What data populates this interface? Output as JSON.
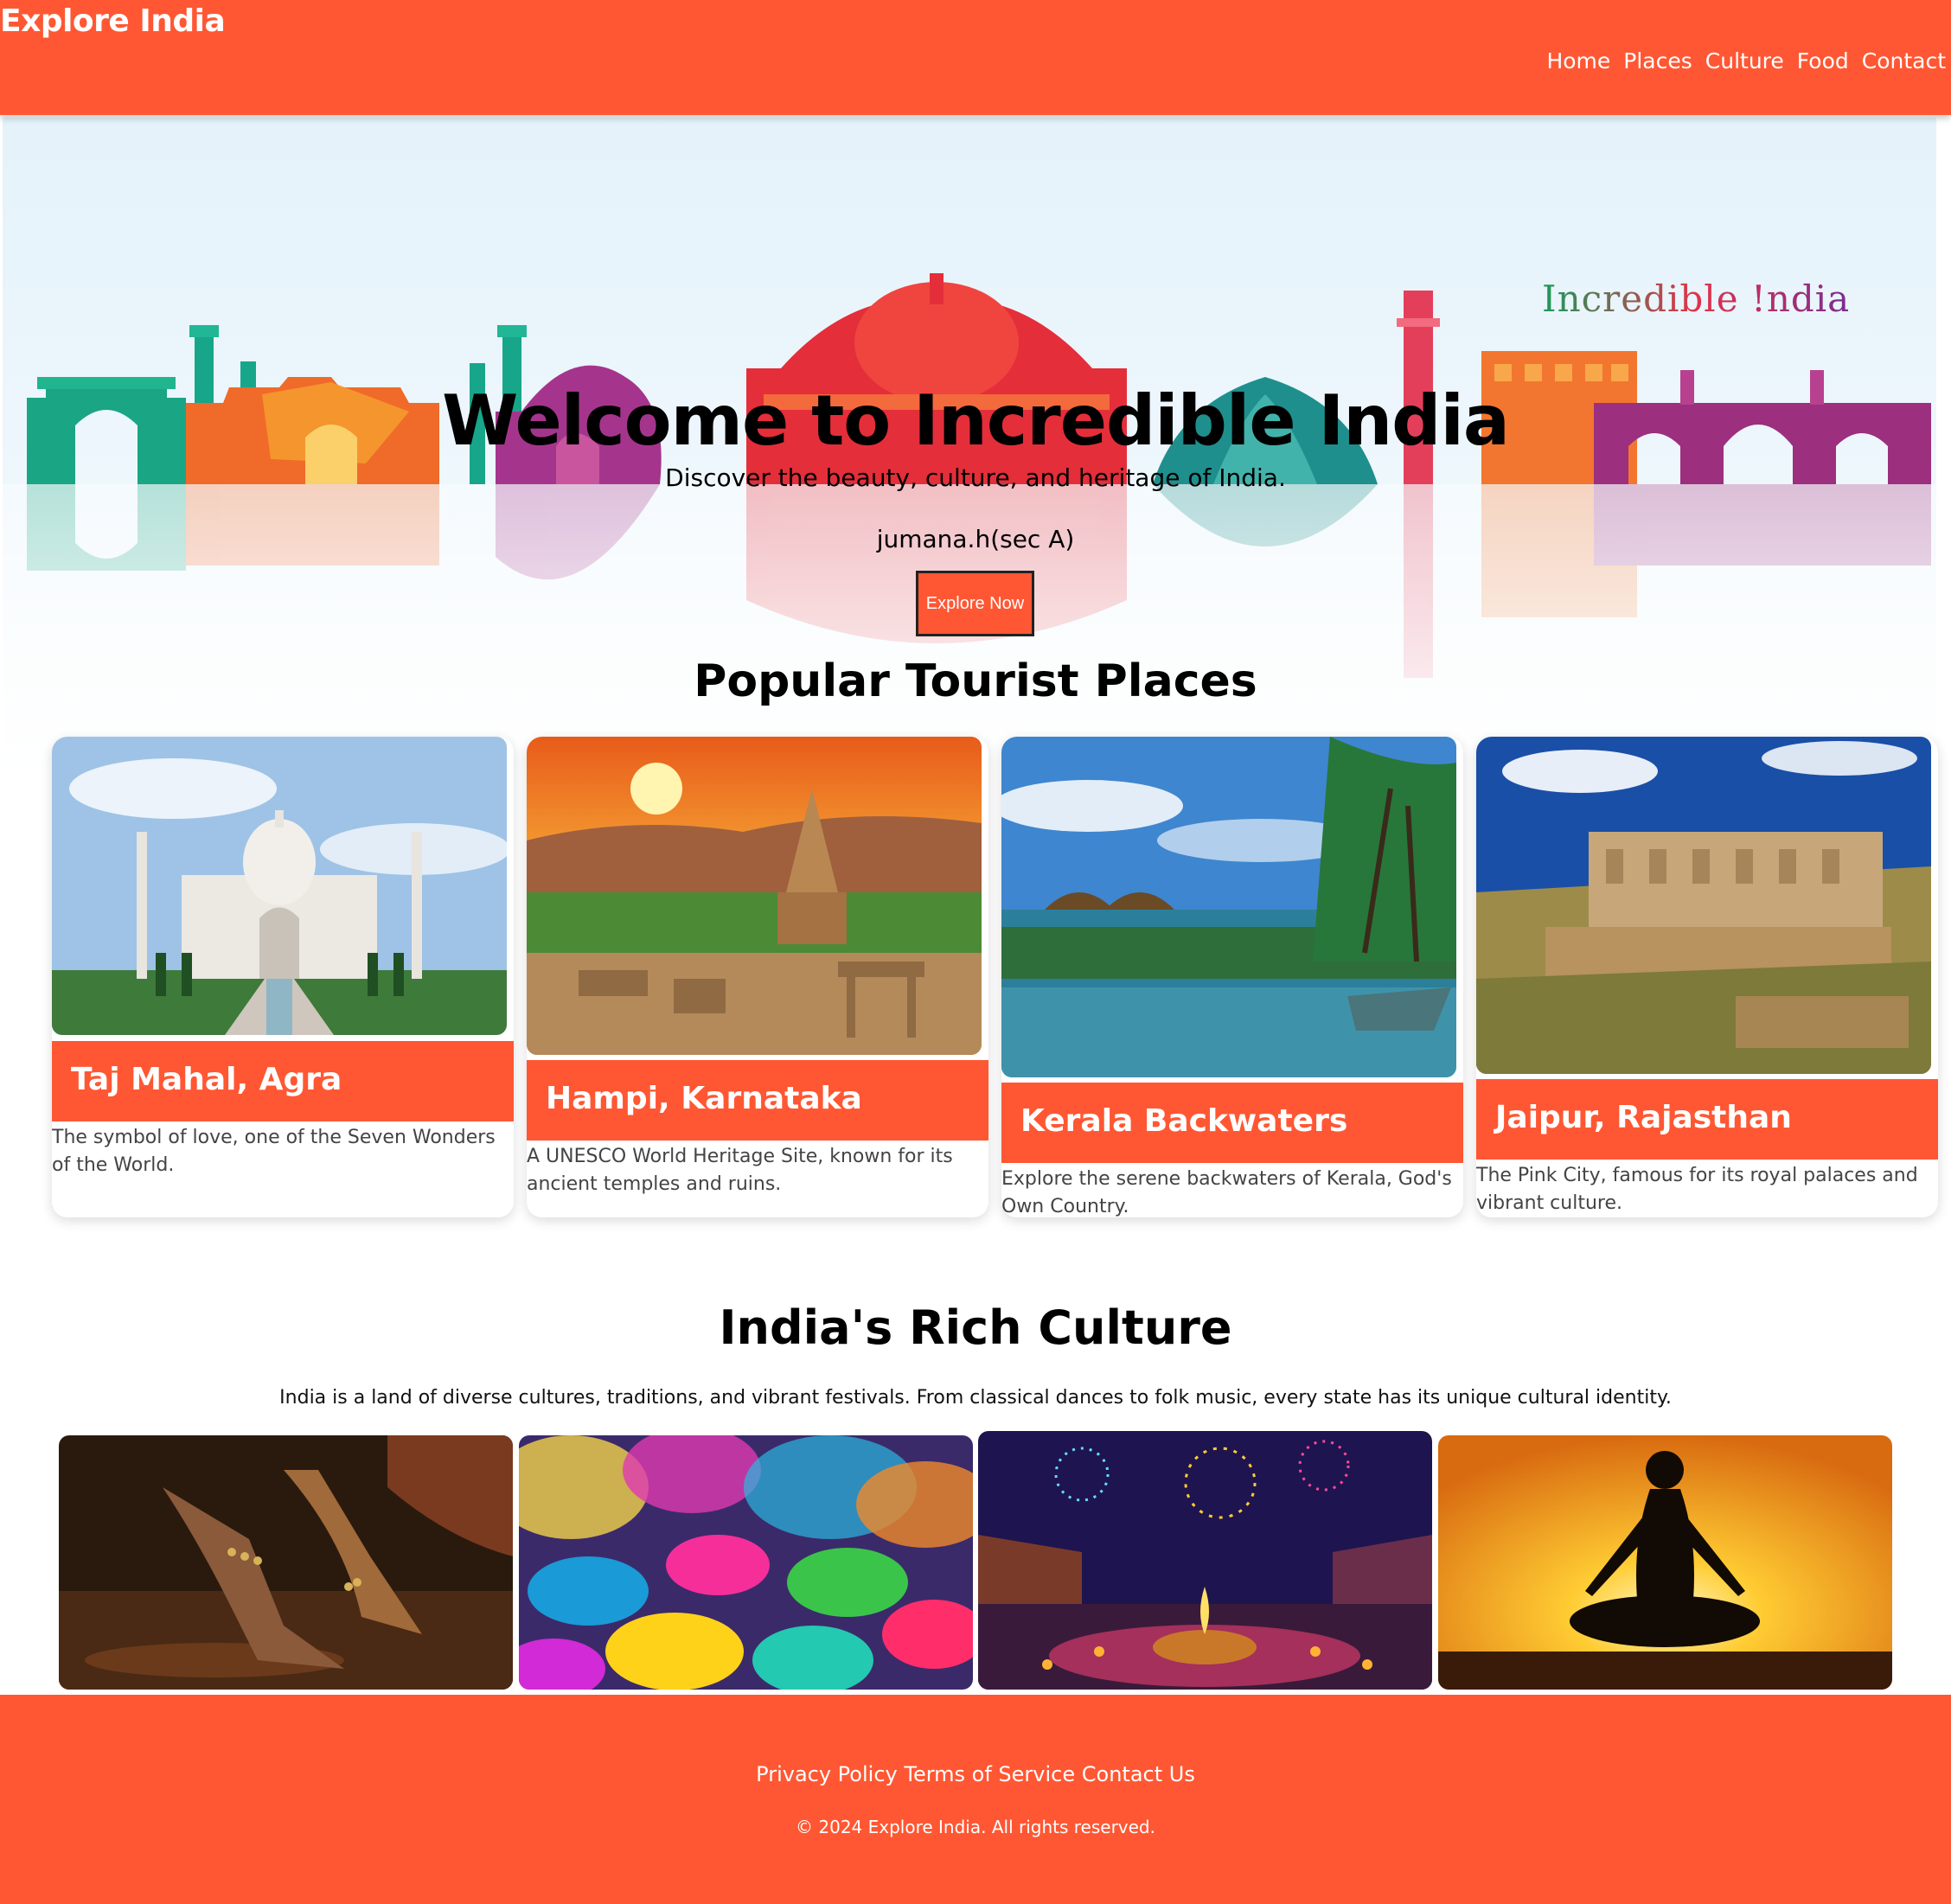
{
  "header": {
    "brand": "Explore India",
    "nav": [
      "Home",
      "Places",
      "Culture",
      "Food",
      "Contact"
    ]
  },
  "hero": {
    "logo_text": "Incredible !ndia",
    "title": "Welcome to Incredible India",
    "subtitle": "Discover the beauty, culture, and heritage of India.",
    "author": "jumana.h(sec A)",
    "button": "Explore Now"
  },
  "places": {
    "title": "Popular Tourist Places",
    "cards": [
      {
        "title": "Taj Mahal, Agra",
        "desc": "The symbol of love, one of the Seven Wonders of the World."
      },
      {
        "title": "Hampi, Karnataka",
        "desc": "A UNESCO World Heritage Site, known for its ancient temples and ruins."
      },
      {
        "title": "Kerala Backwaters",
        "desc": "Explore the serene backwaters of Kerala, God's Own Country."
      },
      {
        "title": "Jaipur, Rajasthan",
        "desc": "The Pink City, famous for its royal palaces and vibrant culture."
      }
    ]
  },
  "culture": {
    "title": "India's Rich Culture",
    "text": "India is a land of diverse cultures, traditions, and vibrant festivals. From classical dances to folk music, every state has its unique cultural identity."
  },
  "footer": {
    "links": [
      "Privacy Policy",
      "Terms of Service",
      "Contact Us"
    ],
    "copyright": "© 2024 Explore India. All rights reserved."
  },
  "colors": {
    "accent": "#ff5733",
    "hero_bg": "#eaf5fb"
  }
}
